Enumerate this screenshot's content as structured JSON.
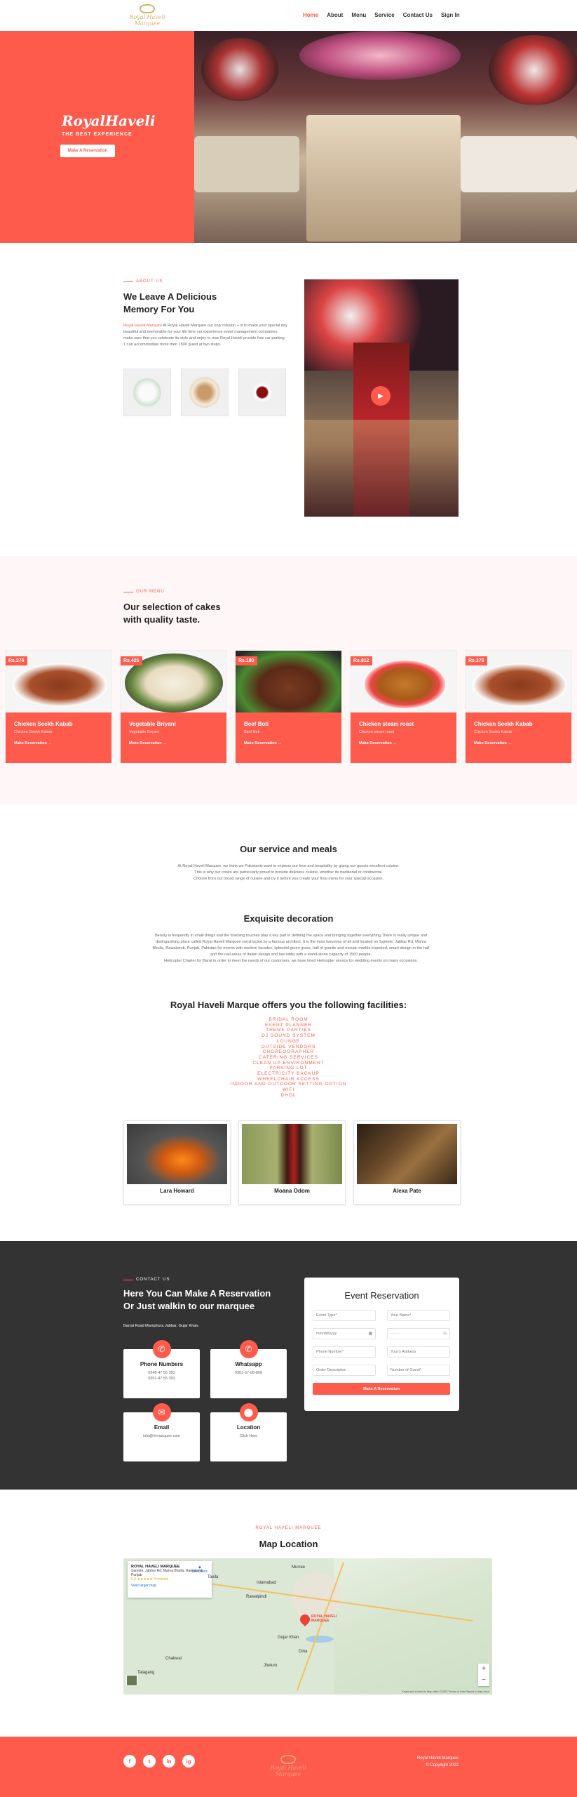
{
  "nav": {
    "logo_text": "Royal Haveli Marquee",
    "items": [
      {
        "label": "Home",
        "active": true
      },
      {
        "label": "About"
      },
      {
        "label": "Menu"
      },
      {
        "label": "Service"
      },
      {
        "label": "Contact Us"
      },
      {
        "label": "Sign In"
      }
    ]
  },
  "hero": {
    "script_title": "RoyalHaveli",
    "subtitle": "THE BEST EXPERIENCE",
    "button": "Make A Reservation"
  },
  "about": {
    "kicker": "ABOUT US",
    "title_line1": "We Leave A Delicious",
    "title_line2": "Memory For You",
    "link_text": "Royal Haveli Marquee",
    "paragraph": "At Royal Haveli Marquee our only mission + is to make your special day beautiful and memorable for your life time our experience event management companies make sure that you celebrate its style and enjoy to max Royal Haveli provide free car parking 1 can accommodate more then 1500 guest at two steps."
  },
  "menu_section": {
    "kicker": "OUR MENU",
    "title_line1": "Our selection of cakes",
    "title_line2": "with quality taste.",
    "cards": [
      {
        "price": "Rs.276",
        "title": "Chicken Seekh Kabab",
        "desc": "Chicken Seekh Kabab",
        "link": "Make Reservation →"
      },
      {
        "price": "Rs.425",
        "title": "Vegetable Briyani",
        "desc": "Vegetable Briyani",
        "link": "Make Reservation →"
      },
      {
        "price": "Rs.180",
        "title": "Beef Boti",
        "desc": "Beef Boti",
        "link": "Make Reservation →"
      },
      {
        "price": "Rs.812",
        "title": "Chicken steam roast",
        "desc": "Chicken steam roast",
        "link": "Make Reservation →"
      },
      {
        "price": "Rs.276",
        "title": "Chicken Seekh Kabab",
        "desc": "Chicken Seekh Kabab",
        "link": "Make Reservation →"
      }
    ]
  },
  "service": {
    "title": "Our service and meals",
    "lines": [
      "At Royal Haveli Marquee, we think we Pakistanis want to express our love and hospitality by giving our guests excellent cuisine.",
      "This is why our cooks are particularly proud to provide delicious cuisine, whether its traditional or continental.",
      "Choose from our broad range of cuisine and try it before you create your final menu for your special occasion."
    ]
  },
  "decoration": {
    "title": "Exquisite decoration",
    "lines": [
      "Beauty is frequently in small things and the finishing touches play a key part in defining the space and bringing together everything.There is really unique and",
      "distinguishing place called Royal Haveli Marquee constructed by a famous architect. It is the most luxurious of all and located on Samote, Jabbar Rd, Manra",
      "Bhulla, Rawalpindi, Punjab, Pakistan for events with modern facades, splendid green grass, hall of granite and mosaic marble imported, smart design in the hall",
      "and the nail areas of Italian design and low lobby with a stand-alone capacity of 1500 people.",
      "Helicopter Charter for Barat in order to meet the needs of our customers, we have hired Helicopter service for wedding events on many occasions."
    ]
  },
  "facilities": {
    "title": "Royal Haveli Marque offers you the following facilities:",
    "items": [
      "BRIDAL ROOM",
      "EVENT PLANNER",
      "THEME PARTIES",
      "DJ SOUND SYSTEM",
      "LOUNGE",
      "OUTSIDE VENDORS",
      "CHOREOGRAPHER",
      "CATERING SERVICES",
      "CLEAN UP ENVIRONMENT",
      "PARKING LOT",
      "ELECTRICITY BACKUP",
      "WHEELCHAIR ACCESS",
      "INDOOR AND OUTDOOR SETTING OPTION",
      "WIFI",
      "DHOL"
    ]
  },
  "people": [
    {
      "name": "Lara Howard"
    },
    {
      "name": "Moana Odom"
    },
    {
      "name": "Alexa Pate"
    }
  ],
  "contact": {
    "kicker": "CONTACT US",
    "title_line1": "Here You Can Make A Reservation",
    "title_line2": "Or Just walkin to our marquee",
    "address": "Barrat Road Mamphura Jabbar, Gujar Khan.",
    "boxes": [
      {
        "title": "Phone Numbers",
        "line1": "0346-47 55 393",
        "line2": "0301-47 55 393"
      },
      {
        "title": "Whatsapp",
        "line1": "0302-57-08-808",
        "line2": ""
      },
      {
        "title": "Email",
        "line1": "info@rhmarquee.com",
        "line2": ""
      },
      {
        "title": "Location",
        "line1": "Click Here",
        "line2": ""
      }
    ],
    "form": {
      "title": "Event Reservation",
      "event_type": "Event Type*",
      "your_name": "Your Name*",
      "date": "mm/dd/yyyy",
      "time": "--:-- --",
      "phone": "Phone Number*",
      "address": "Your's Address",
      "order": "Order Description",
      "guests": "Number of Guest*",
      "submit": "Make A Reservation"
    }
  },
  "map": {
    "kicker": "ROYAL HAVELI MARQUEE",
    "title": "Map Location",
    "place_name": "ROYAL HAVELI MARQUEE",
    "place_address": "Samote, Jabbar Rd, Manra Bhulla, Rawalpindi, Punjab",
    "rating": "5.0 ★★★★★ 3 reviews",
    "larger_map": "View larger map",
    "directions": "Directions",
    "labels": [
      "Islamabad",
      "Rawalpindi",
      "ROYAL HAVELI MARQUEE",
      "Taxila",
      "Murree",
      "Chakwal",
      "Jhelum",
      "Gujar Khan",
      "Talagang",
      "Dina"
    ],
    "footer_text": "Keyboard shortcuts   Map data ©2022   Terms of Use   Report a map error"
  },
  "footer": {
    "socials": [
      "f",
      "t",
      "in",
      "ig"
    ],
    "logo_text": "Royal Haveli Marquee",
    "brand": "Royal Haveli Marquee",
    "copyright": "© Copyright 2022"
  }
}
